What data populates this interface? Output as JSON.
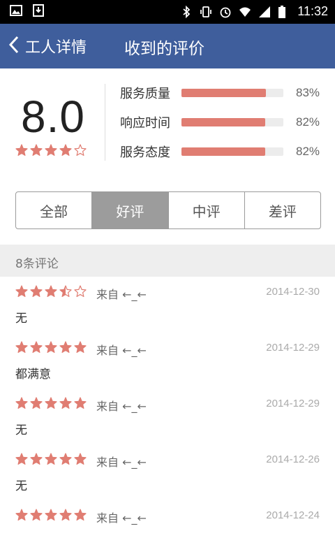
{
  "status_bar": {
    "time": "11:32",
    "left_icons": [
      "image-icon",
      "download-icon"
    ],
    "right_icons": [
      "bluetooth-icon",
      "vibrate-icon",
      "alarm-icon",
      "wifi-icon",
      "signal-icon",
      "battery-icon"
    ]
  },
  "header": {
    "back_label": "工人详情",
    "title": "收到的评价"
  },
  "summary": {
    "score": "8.0",
    "stars": 4,
    "metrics": [
      {
        "label": "服务质量",
        "percent": 83,
        "percent_text": "83%"
      },
      {
        "label": "响应时间",
        "percent": 82,
        "percent_text": "82%"
      },
      {
        "label": "服务态度",
        "percent": 82,
        "percent_text": "82%"
      }
    ]
  },
  "tabs": [
    {
      "label": "全部",
      "active": false
    },
    {
      "label": "好评",
      "active": true
    },
    {
      "label": "中评",
      "active": false
    },
    {
      "label": "差评",
      "active": false
    }
  ],
  "review_count": "8条评论",
  "reviews": [
    {
      "stars": 3.5,
      "from": "来自 ←_←",
      "date": "2014-12-30",
      "text": "无"
    },
    {
      "stars": 5,
      "from": "来自 ←_←",
      "date": "2014-12-29",
      "text": "都满意"
    },
    {
      "stars": 5,
      "from": "来自 ←_←",
      "date": "2014-12-29",
      "text": "无"
    },
    {
      "stars": 5,
      "from": "来自 ←_←",
      "date": "2014-12-26",
      "text": "无"
    },
    {
      "stars": 5,
      "from": "来自 ←_←",
      "date": "2014-12-24",
      "text": ""
    }
  ],
  "colors": {
    "header_bg": "#3f5e9c",
    "accent": "#e07d72",
    "tab_active_bg": "#9c9c9c"
  }
}
